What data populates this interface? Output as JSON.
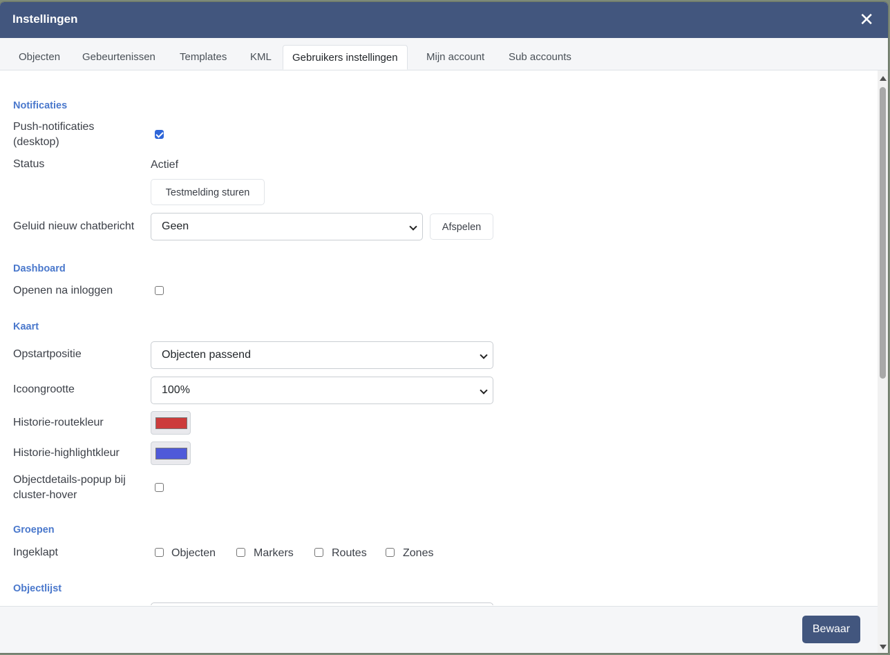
{
  "header": {
    "title": "Instellingen",
    "close_glyph": "✕"
  },
  "tabs": [
    {
      "label": "Objecten"
    },
    {
      "label": "Gebeurtenissen"
    },
    {
      "label": "Templates"
    },
    {
      "label": "KML"
    },
    {
      "label": "Gebruikers instellingen",
      "active": true
    },
    {
      "label": "Mijn account"
    },
    {
      "label": "Sub accounts"
    }
  ],
  "notificaties": {
    "title": "Notificaties",
    "push_label_line1": "Push-notificaties",
    "push_label_line2": "(desktop)",
    "push_checked": true,
    "status_label": "Status",
    "status_value": "Actief",
    "test_button": "Testmelding sturen",
    "sound_label": "Geluid nieuw chatbericht",
    "sound_value": "Geen",
    "play_button": "Afspelen"
  },
  "dashboard": {
    "title": "Dashboard",
    "open_label": "Openen na inloggen",
    "open_checked": false
  },
  "kaart": {
    "title": "Kaart",
    "startup_label": "Opstartpositie",
    "startup_value": "Objecten passend",
    "icon_size_label": "Icoongrootte",
    "icon_size_value": "100%",
    "route_color_label": "Historie-routekleur",
    "route_color": "#cc3b3b",
    "highlight_color_label": "Historie-highlightkleur",
    "highlight_color": "#4f5ad9",
    "popup_label_line1": "Objectdetails-popup bij",
    "popup_label_line2": "cluster-hover",
    "popup_checked": false
  },
  "groepen": {
    "title": "Groepen",
    "collapsed_label": "Ingeklapt",
    "options": [
      {
        "label": "Objecten",
        "checked": false
      },
      {
        "label": "Markers",
        "checked": false
      },
      {
        "label": "Routes",
        "checked": false
      },
      {
        "label": "Zones",
        "checked": false
      }
    ]
  },
  "objectlijst": {
    "title": "Objectlijst"
  },
  "footer": {
    "save_button": "Bewaar"
  }
}
